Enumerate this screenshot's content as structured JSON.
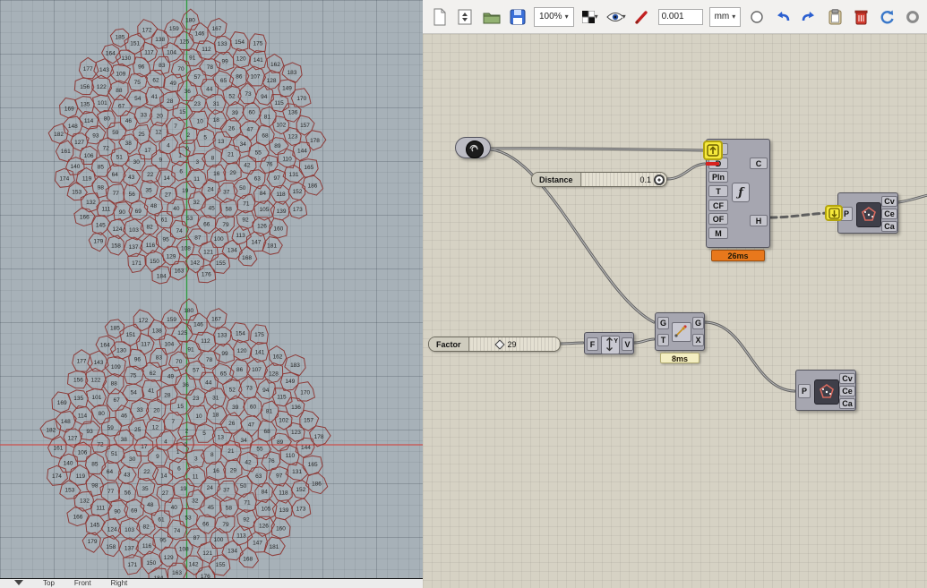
{
  "viewport": {
    "bg": "#a7b1b8",
    "cell_count": 187,
    "cell_stroke": "#8e3b38",
    "label_color": "#262626",
    "axis_vertical_color": "#2f9e3f",
    "axis_horizontal_color": "#cc4f4c",
    "tabs": [
      "Top",
      "Front",
      "Right"
    ]
  },
  "toolbar": {
    "zoom": "100%",
    "tolerance": "0.001",
    "units": "mm",
    "caret": "▾",
    "icons": [
      "new-file-icon",
      "file-updown-icon",
      "open-folder-icon",
      "save-icon",
      "zoom-select",
      "pattern-swatch-icon",
      "display-eye-icon",
      "red-pen-icon",
      "tolerance-input",
      "units-select",
      "circle-icon",
      "undo-icon",
      "redo-icon",
      "clipboard-icon",
      "delete-icon",
      "refresh-icon",
      "ring-icon"
    ]
  },
  "gh": {
    "pipeline": {
      "icon": "pipeline-sphere-icon"
    },
    "distance_slider": {
      "label": "Distance",
      "value": "0.1"
    },
    "factor_slider": {
      "label": "Factor",
      "value": "29"
    },
    "main_component": {
      "inputs": [
        "P",
        "D",
        "Pln",
        "T",
        "CF",
        "OF",
        "M"
      ],
      "outputs": [
        "C",
        "H"
      ],
      "icon_glyph": "ƒ",
      "runtime": "26ms"
    },
    "move": {
      "inputs": [
        "G",
        "T"
      ],
      "outputs": [
        "G",
        "X"
      ],
      "runtime": "8ms"
    },
    "unit_vector": {
      "input": "F",
      "output": "V",
      "icon_label": "Y"
    },
    "cell1": {
      "input": "P",
      "outputs": [
        "Cv",
        "Ce",
        "Ca"
      ]
    },
    "cell2": {
      "input": "P",
      "outputs": [
        "Cv",
        "Ce",
        "Ca"
      ]
    }
  }
}
